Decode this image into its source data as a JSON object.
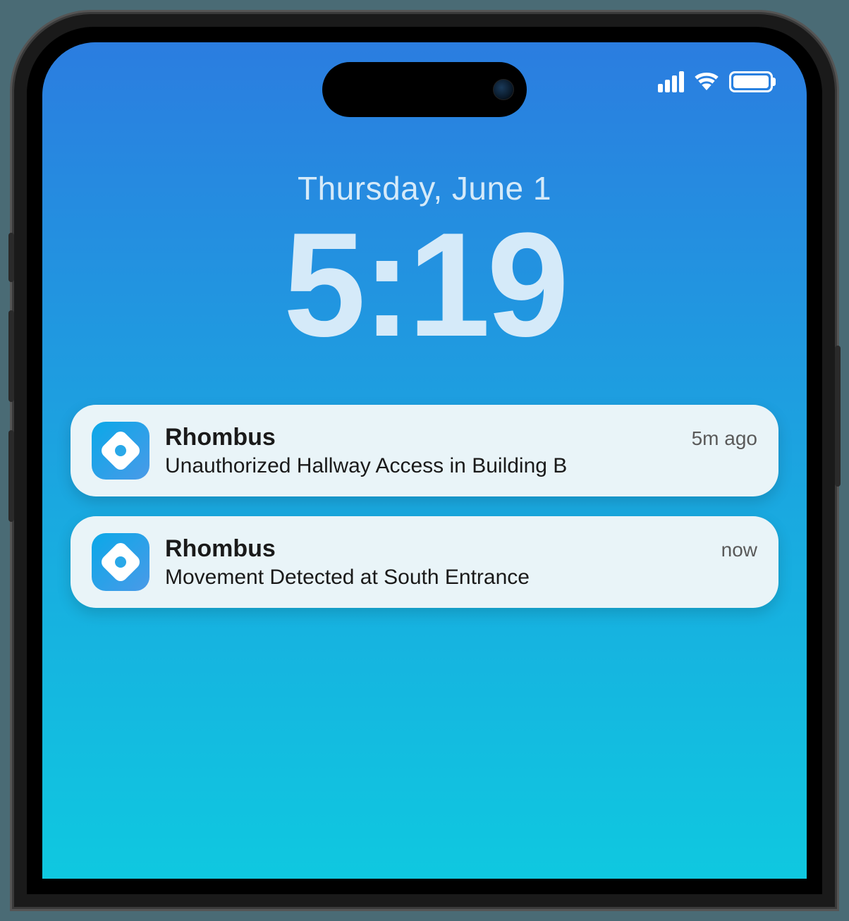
{
  "lockscreen": {
    "date": "Thursday, June 1",
    "time": "5:19"
  },
  "notifications": [
    {
      "app_name": "Rhombus",
      "timestamp": "5m ago",
      "message": "Unauthorized Hallway Access in Building B"
    },
    {
      "app_name": "Rhombus",
      "timestamp": "now",
      "message": "Movement Detected at South Entrance"
    }
  ]
}
